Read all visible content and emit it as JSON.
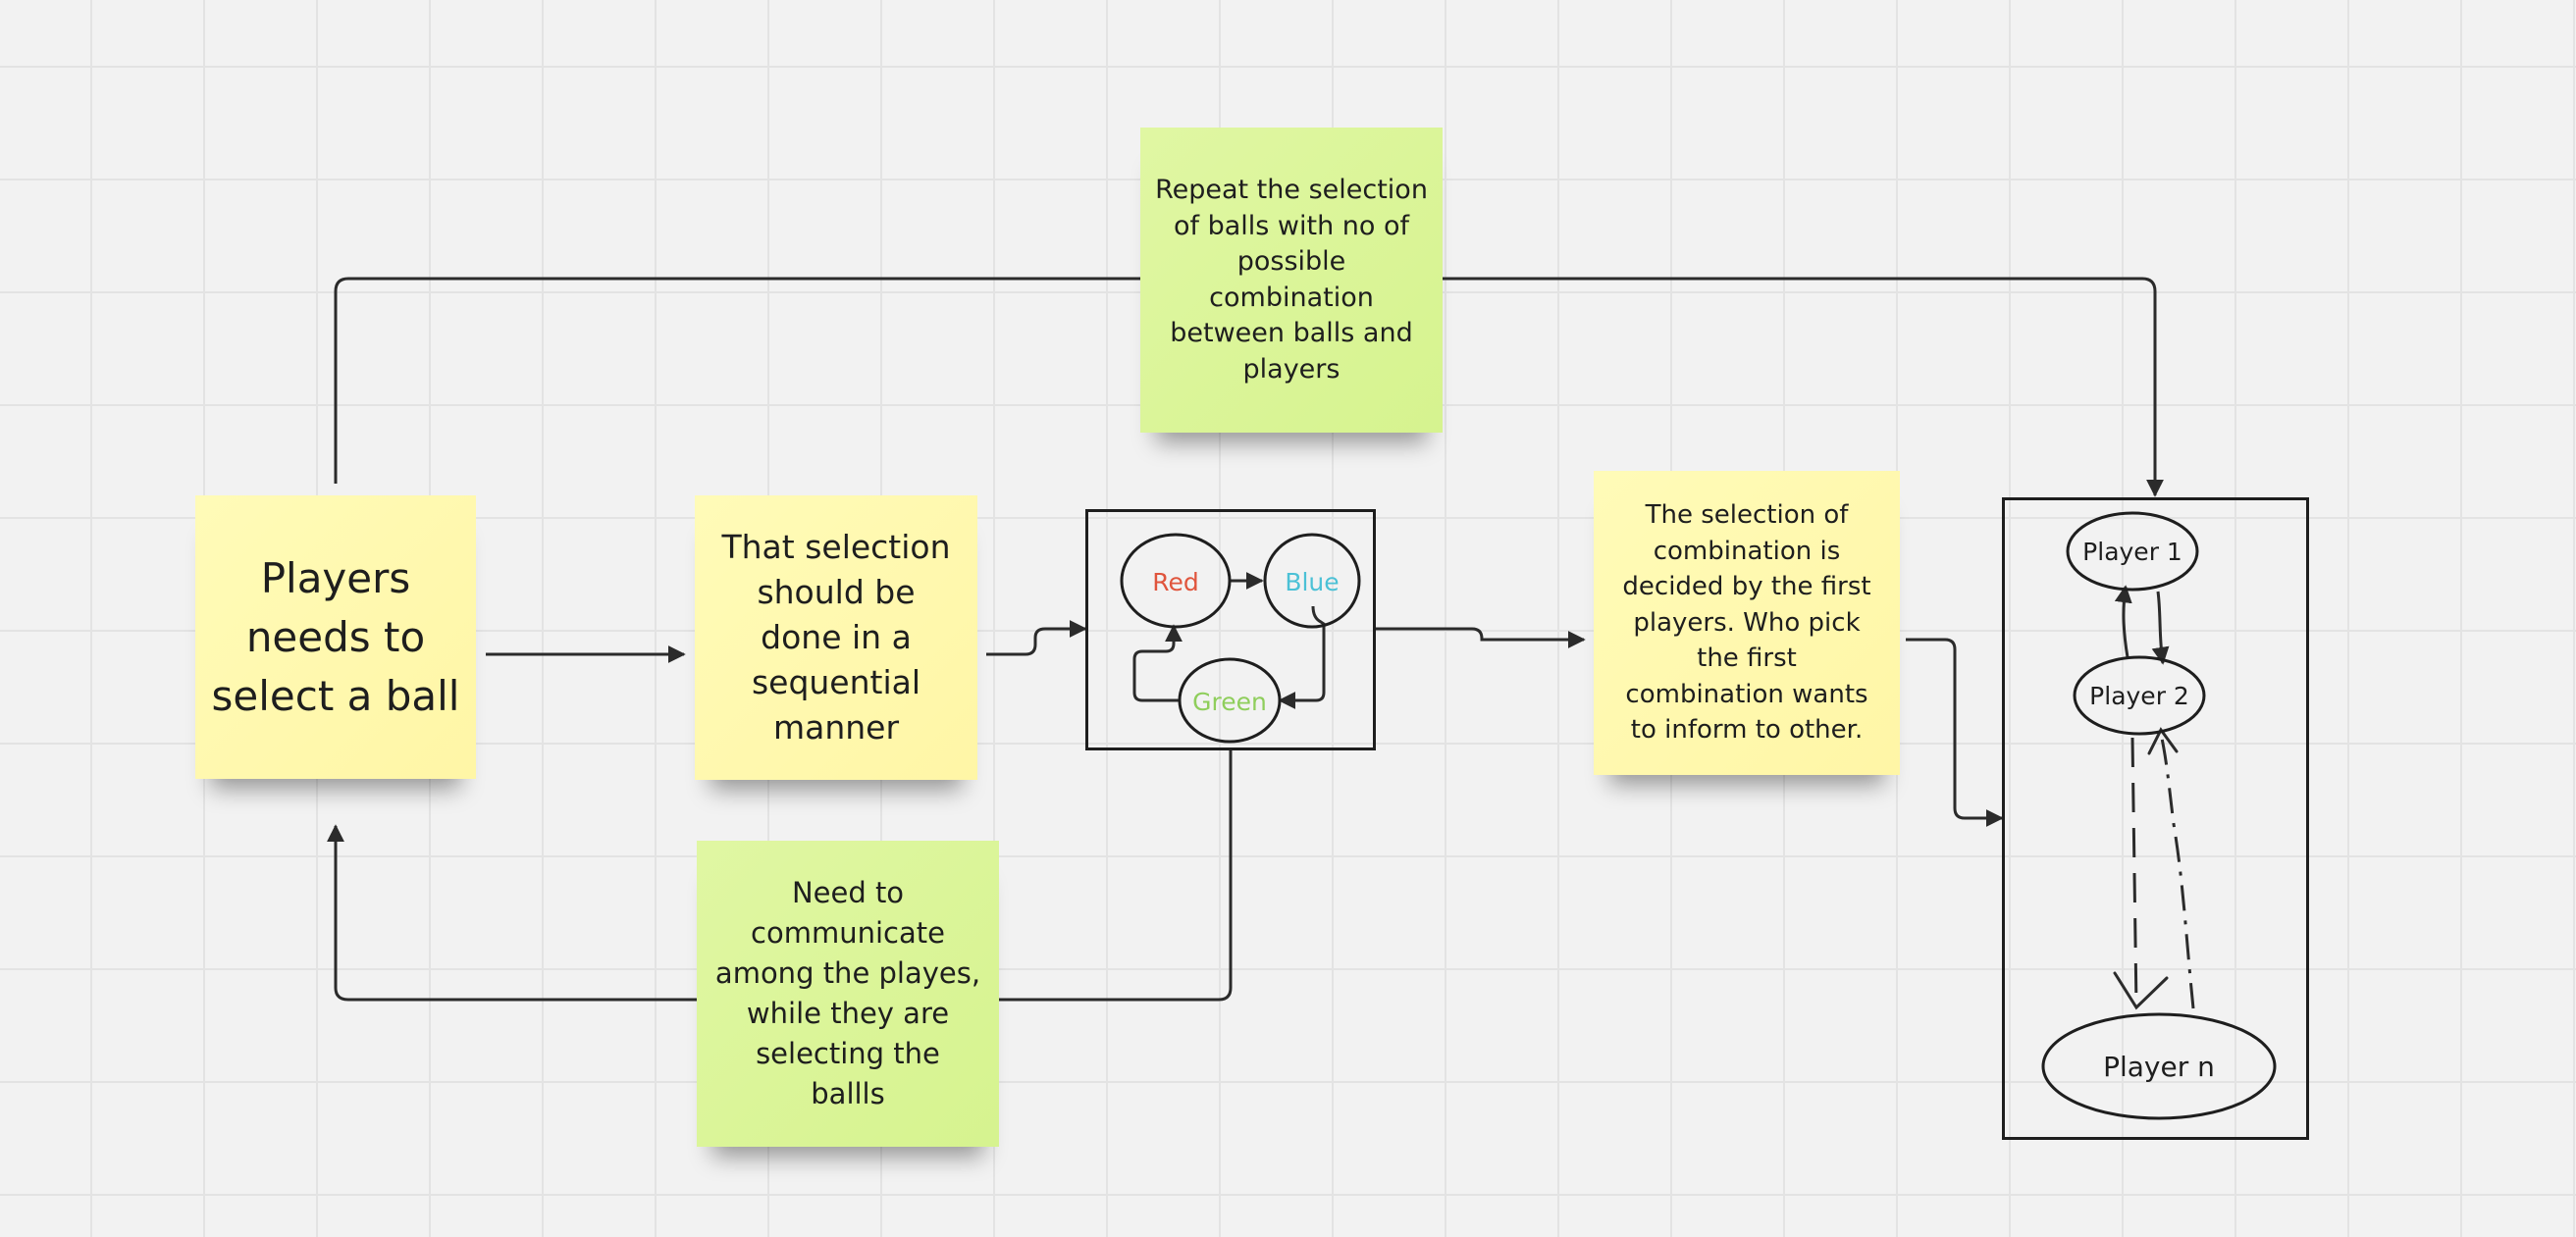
{
  "stickies": {
    "players_select": "Players\nneeds to\nselect a ball",
    "sequential": "That selection\nshould be\ndone in a\nsequential\nmanner",
    "repeat_selection": "Repeat the selection\nof balls with no of\npossible\ncombination\nbetween balls and\nplayers",
    "communicate": "Need to\ncommunicate\namong the playes,\nwhile they are\nselecting the\nballls",
    "first_player_decides": "The selection of\ncombination is\ndecided by the first\nplayers. Who pick\nthe first\ncombination wants\nto inform to other."
  },
  "balls": {
    "red": "Red",
    "blue": "Blue",
    "green": "Green"
  },
  "players": {
    "player1": "Player 1",
    "player2": "Player 2",
    "playern": "Player n"
  },
  "colors": {
    "sticky_yellow": "#fff9b1",
    "sticky_green": "#dbf59a",
    "red_label": "#e0553d",
    "blue_label": "#4cc1d6",
    "green_label": "#8fce5c",
    "line": "#2b2b2b"
  }
}
